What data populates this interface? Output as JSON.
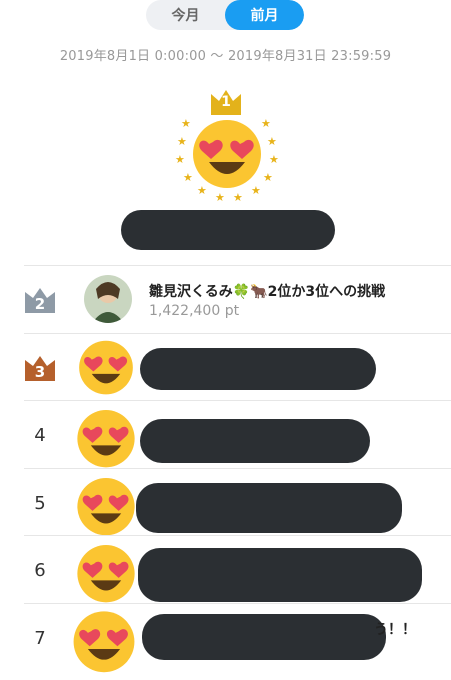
{
  "tabs": [
    {
      "label": "今月",
      "active": false
    },
    {
      "label": "前月",
      "active": true
    }
  ],
  "period": "2019年8月1日 0:00:00 〜 2019年8月31日 23:59:59",
  "winner": {
    "rank": "1",
    "icon": "heart-eyes-face-icon",
    "crown_color": "#e3b21b"
  },
  "ranking": [
    {
      "rank": "2",
      "name": "雛見沢くるみ🍀🐂2位か3位への挑戦",
      "points": "1,422,400 pt",
      "badge_color": "#8e9aa6"
    },
    {
      "rank": "3",
      "badge_color": "#b5602c"
    },
    {
      "rank": "4"
    },
    {
      "rank": "5"
    },
    {
      "rank": "6"
    },
    {
      "rank": "7",
      "tail": "う！！"
    }
  ],
  "colors": {
    "accent": "#1a9df2",
    "redaction": "#2b2f33"
  }
}
